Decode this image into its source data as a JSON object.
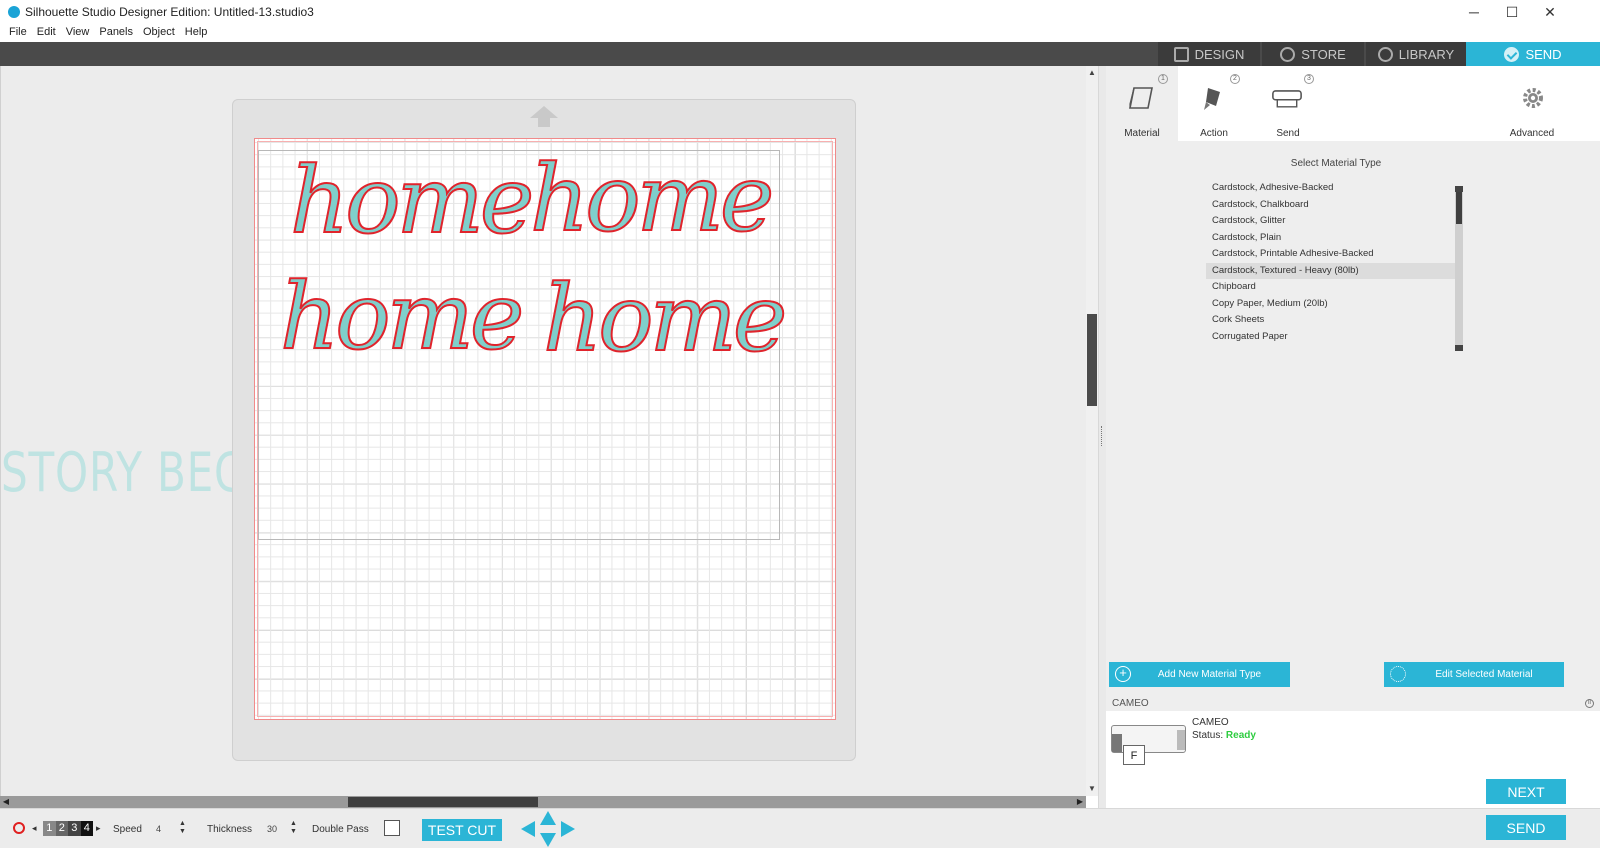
{
  "window": {
    "title": "Silhouette Studio Designer Edition: Untitled-13.studio3",
    "minimize": "─",
    "maximize": "☐",
    "close": "✕"
  },
  "menu": [
    "File",
    "Edit",
    "View",
    "Panels",
    "Object",
    "Help"
  ],
  "nav": {
    "tabs": [
      {
        "label": "DESIGN",
        "icon": "grid-icon",
        "active": false
      },
      {
        "label": "STORE",
        "icon": "silhouette-s-icon",
        "active": false
      },
      {
        "label": "LIBRARY",
        "icon": "cloud-download-icon",
        "active": false
      },
      {
        "label": "SEND",
        "icon": "checkmark-icon",
        "active": true
      }
    ],
    "active_color": "#2bb5d6"
  },
  "canvas": {
    "background_text": "STORY BEGINS",
    "words": [
      "home",
      "home",
      "home",
      "home"
    ],
    "fill_color": "#7fcfcb",
    "cut_line_color": "#e0242c"
  },
  "panel": {
    "tabs": [
      {
        "label": "Material",
        "num": "1",
        "icon": "material-icon"
      },
      {
        "label": "Action",
        "num": "2",
        "icon": "blade-icon"
      },
      {
        "label": "Send",
        "num": "3",
        "icon": "cutter-machine-icon"
      },
      {
        "label": "Advanced",
        "icon": "gear-icon"
      }
    ],
    "section_title": "Select Material Type",
    "materials": [
      "Cardstock, Adhesive-Backed",
      "Cardstock, Chalkboard",
      "Cardstock, Glitter",
      "Cardstock, Plain",
      "Cardstock, Printable Adhesive-Backed",
      "Cardstock, Textured - Heavy (80lb)",
      "Chipboard",
      "Copy Paper, Medium (20lb)",
      "Cork Sheets",
      "Corrugated Paper"
    ],
    "selected_material": "Cardstock, Textured - Heavy (80lb)",
    "add_material": "Add New Material Type",
    "edit_material": "Edit Selected Material",
    "device": {
      "header": "CAMEO",
      "name": "CAMEO",
      "status_label": "Status:",
      "status_value": "Ready",
      "tool_letter": "F"
    },
    "next_label": "NEXT",
    "send_label": "SEND"
  },
  "toolbar": {
    "tool_numbers": [
      "1",
      "2",
      "3",
      "4"
    ],
    "speed_label": "Speed",
    "speed_value": "4",
    "thickness_label": "Thickness",
    "thickness_value": "30",
    "double_pass_label": "Double Pass",
    "double_pass_checked": false,
    "test_cut_label": "TEST CUT"
  }
}
